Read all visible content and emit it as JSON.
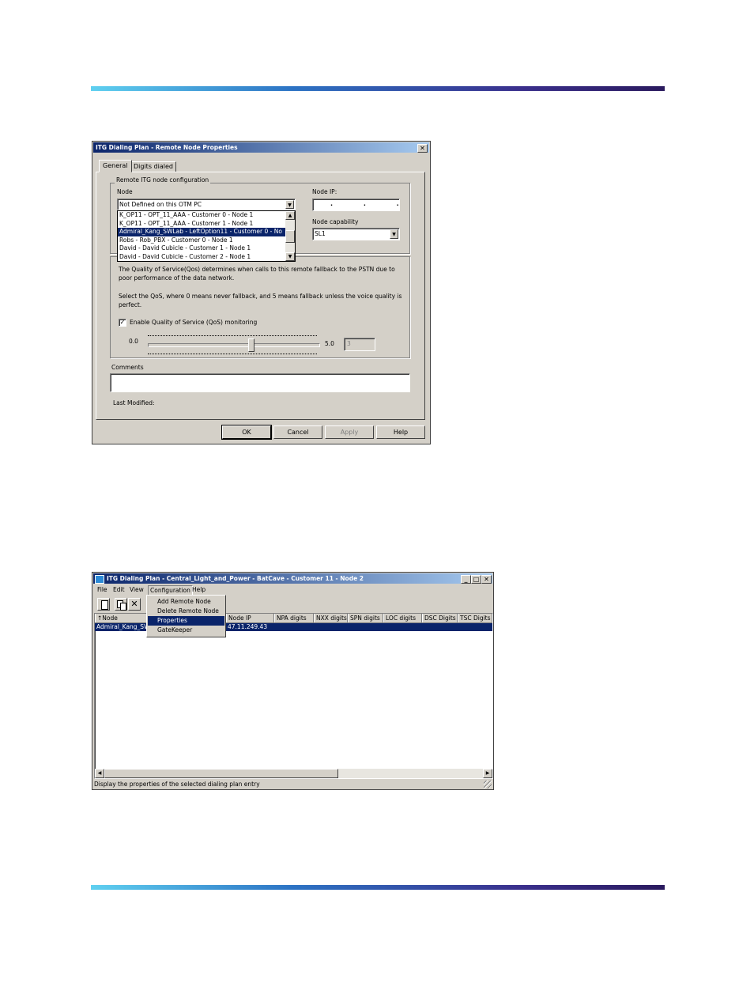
{
  "dialog": {
    "title": "ITG Dialing Plan - Remote Node Properties",
    "tabs": [
      "General",
      "Digits dialed"
    ],
    "group_label": "Remote ITG node configuration",
    "node_label": "Node",
    "node_value": "Not Defined on this OTM PC",
    "node_options": [
      "K_OP11 - OPT_11_AAA - Customer 0 - Node 1",
      "K_OP11 - OPT_11_AAA - Customer 1 - Node 1",
      "Admiral_Kang_SWLab - LeftOption11 - Customer 0 - No",
      "Robs - Rob_PBX - Customer 0 - Node 1",
      "David - David Cubicle - Customer 1 - Node 1",
      "David - David Cubicle - Customer 2 - Node 1"
    ],
    "node_ip_label": "Node IP:",
    "node_ip_value": ". . .",
    "capability_label": "Node capability",
    "capability_value": "SL1",
    "qos_text_1": "The Quality of Service(Qos) determines when calls to this remote fallback to the PSTN due to poor performance of the data network.",
    "qos_text_2": "Select the QoS, where 0 means never fallback, and 5 means fallback unless the voice quality is perfect.",
    "qos_checkbox_label": "Enable Quality of Service (QoS) monitoring",
    "qos_checked": true,
    "slider_min": "0.0",
    "slider_max": "5.0",
    "slider_value_text": "3",
    "slider_level": 0.6,
    "comments_label": "Comments",
    "comments_value": "",
    "last_modified_label": "Last Modified:",
    "buttons": {
      "ok": "OK",
      "cancel": "Cancel",
      "apply": "Apply",
      "help": "Help"
    },
    "close_glyph": "✕"
  },
  "main": {
    "title": "ITG Dialing Plan - Central_Light_and_Power - BatCave - Customer 11 - Node 2",
    "menu": [
      "File",
      "Edit",
      "View",
      "Configuration",
      "Help"
    ],
    "config_menu": [
      "Add Remote Node",
      "Delete Remote Node",
      "Properties",
      "GateKeeper"
    ],
    "config_selected_index": 2,
    "columns": [
      "Node",
      "Node IP",
      "NPA digits",
      "NXX digits",
      "SPN digits",
      "LOC digits",
      "DSC Digits",
      "TSC Digits"
    ],
    "sort_glyph": "↑",
    "row": {
      "node": "Admiral_Kang_SWL",
      "node_ip": "47.11.249.43"
    },
    "status": "Display the properties of the selected dialing plan entry",
    "win_buttons": [
      "_",
      "□",
      "✕"
    ],
    "toolbar_icons": [
      "new-icon",
      "copy-icon",
      "delete-icon"
    ],
    "toolbar_delete_glyph": "✕"
  }
}
